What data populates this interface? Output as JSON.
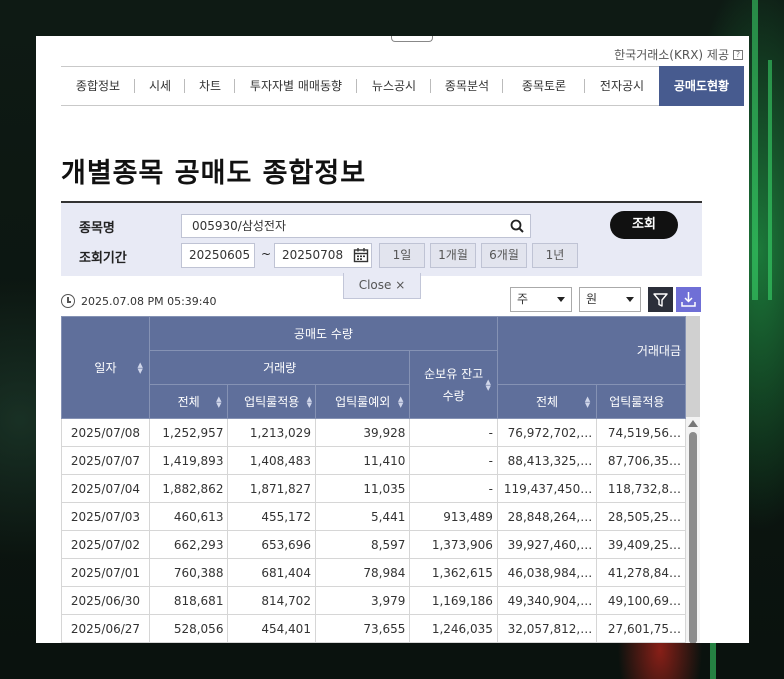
{
  "provider": {
    "text": "한국거래소(KRX) 제공",
    "help": "?"
  },
  "nav": {
    "items": [
      {
        "label": "종합정보"
      },
      {
        "label": "시세"
      },
      {
        "label": "차트"
      },
      {
        "label": "투자자별 매매동향"
      },
      {
        "label": "뉴스공시"
      },
      {
        "label": "종목분석"
      },
      {
        "label": "종목토론"
      },
      {
        "label": "전자공시"
      },
      {
        "label": "공매도현황"
      }
    ],
    "active_color": "#475b8f"
  },
  "page_title": "개별종목 공매도 종합정보",
  "search": {
    "stock_label": "종목명",
    "stock_value": "005930/삼성전자",
    "period_label": "조회기간",
    "date_from": "20250605",
    "tilde": "~",
    "date_to": "20250708",
    "periods": [
      "1일",
      "1개월",
      "6개월",
      "1년"
    ],
    "submit": "조회",
    "close": "Close  ×"
  },
  "timestamp": "2025.07.08 PM 05:39:40",
  "controls": {
    "unit_period": "주",
    "currency": "원"
  },
  "table": {
    "group_short": "공매도 수량",
    "group_amount": "거래대금",
    "sub_volume": "거래량",
    "col_date": "일자",
    "col_balance": "순보유 잔고수량",
    "col_total": "전체",
    "col_uptick": "업틱룰적용",
    "col_except": "업틱룰예외",
    "col_amt_total": "전체",
    "col_amt_uptick": "업틱룰적용",
    "rows": [
      {
        "date": "2025/07/08",
        "total": "1,252,957",
        "uptick": "1,213,029",
        "except": "39,928",
        "balance": "-",
        "amt_total": "76,972,702,…",
        "amt_uptick": "74,519,56…"
      },
      {
        "date": "2025/07/07",
        "total": "1,419,893",
        "uptick": "1,408,483",
        "except": "11,410",
        "balance": "-",
        "amt_total": "88,413,325,…",
        "amt_uptick": "87,706,35…"
      },
      {
        "date": "2025/07/04",
        "total": "1,882,862",
        "uptick": "1,871,827",
        "except": "11,035",
        "balance": "-",
        "amt_total": "119,437,450…",
        "amt_uptick": "118,732,8…"
      },
      {
        "date": "2025/07/03",
        "total": "460,613",
        "uptick": "455,172",
        "except": "5,441",
        "balance": "913,489",
        "amt_total": "28,848,264,…",
        "amt_uptick": "28,505,25…"
      },
      {
        "date": "2025/07/02",
        "total": "662,293",
        "uptick": "653,696",
        "except": "8,597",
        "balance": "1,373,906",
        "amt_total": "39,927,460,…",
        "amt_uptick": "39,409,25…"
      },
      {
        "date": "2025/07/01",
        "total": "760,388",
        "uptick": "681,404",
        "except": "78,984",
        "balance": "1,362,615",
        "amt_total": "46,038,984,…",
        "amt_uptick": "41,278,84…"
      },
      {
        "date": "2025/06/30",
        "total": "818,681",
        "uptick": "814,702",
        "except": "3,979",
        "balance": "1,169,186",
        "amt_total": "49,340,904,…",
        "amt_uptick": "49,100,69…"
      },
      {
        "date": "2025/06/27",
        "total": "528,056",
        "uptick": "454,401",
        "except": "73,655",
        "balance": "1,246,035",
        "amt_total": "32,057,812,…",
        "amt_uptick": "27,601,75…"
      }
    ]
  }
}
